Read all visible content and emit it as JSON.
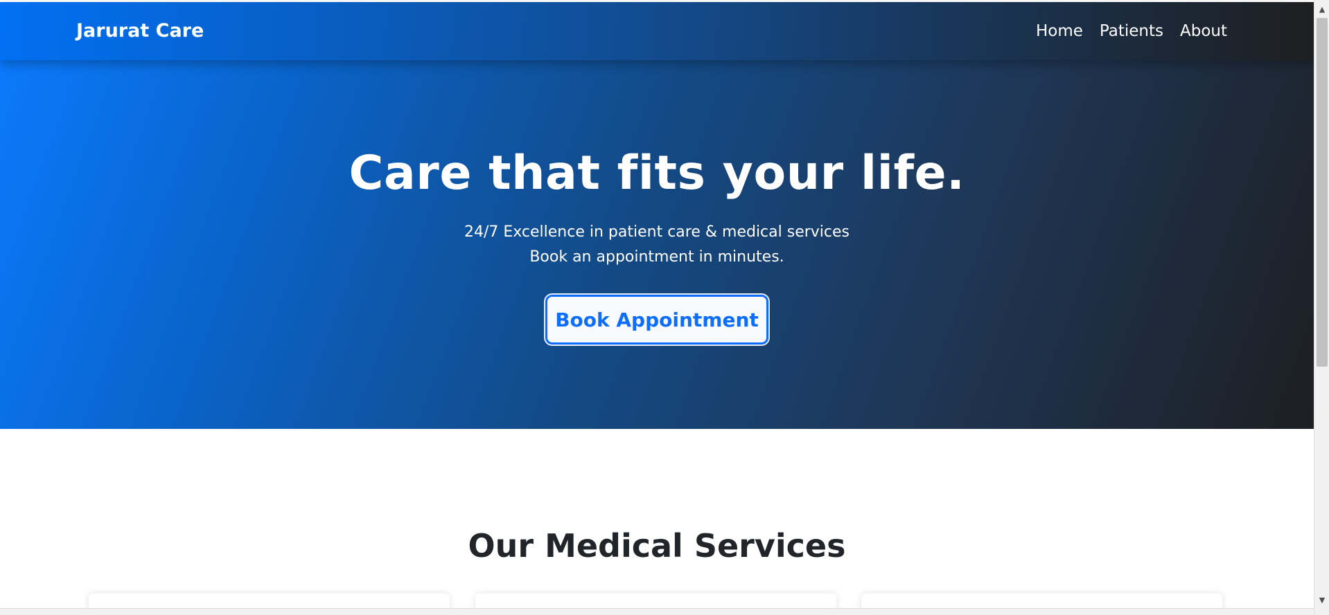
{
  "navbar": {
    "brand": "Jarurat Care",
    "links": [
      {
        "label": "Home"
      },
      {
        "label": "Patients"
      },
      {
        "label": "About"
      }
    ]
  },
  "hero": {
    "title": "Care that fits your life.",
    "subtitle_line1": "24/7 Excellence in patient care & medical services",
    "subtitle_line2": "Book an appointment in minutes.",
    "cta_label": "Book Appointment"
  },
  "services": {
    "title": "Our Medical Services"
  },
  "colors": {
    "primary": "#0d6efd",
    "gradient_start": "#0b7bff",
    "gradient_end": "#1d1f22",
    "heading_text": "#212529"
  },
  "icons": {
    "scroll_up": "triangle-up",
    "scroll_down": "triangle-down"
  }
}
